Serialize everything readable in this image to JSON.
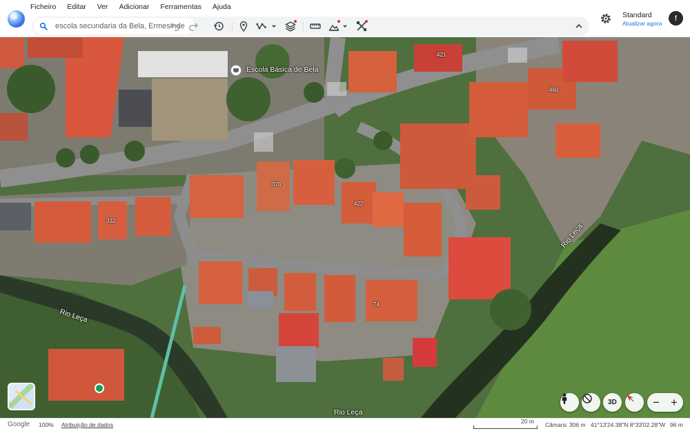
{
  "app": {
    "logo_icon": "earth-globe-icon"
  },
  "menu": [
    "Ficheiro",
    "Editar",
    "Ver",
    "Adicionar",
    "Ferramentas",
    "Ajuda"
  ],
  "search": {
    "value": "escola secundaria da Bela, Ermesinde",
    "icon": "search-icon"
  },
  "toolbar": {
    "icons": [
      "undo-icon",
      "redo-icon",
      "history-icon",
      "placemark-icon",
      "path-icon",
      "layers-icon",
      "ruler-icon",
      "image-overlay-icon",
      "tools-icon",
      "collapse-icon"
    ],
    "notification_color": "#d93025"
  },
  "header": {
    "map_style": "Standard",
    "map_style_action": "Atualizar agora",
    "avatar_letter": "f"
  },
  "map": {
    "poi_label": "Escola Básica de Bela",
    "river_labels": [
      "Rio Leça",
      "Rio Leça",
      "Rio Leça"
    ],
    "house_numbers": [
      "421",
      "460",
      "378",
      "422",
      "332",
      "74"
    ]
  },
  "controls": {
    "three_d_label": "3D",
    "zoom_in": "+",
    "zoom_out": "−"
  },
  "status": {
    "brand": "Google",
    "zoom_level": "100%",
    "attribution": "Atribuição de dados",
    "scale": "20 m",
    "camera": "Câmara: 306 m",
    "coordinates": "41°13'24.38\"N 8°33'02.28\"W",
    "elevation": "96 m"
  },
  "colors": {
    "roof": "#d9573c",
    "road": "#8a8a8a",
    "vegetation": "#4a6b3a",
    "accent": "#1a73e8"
  }
}
